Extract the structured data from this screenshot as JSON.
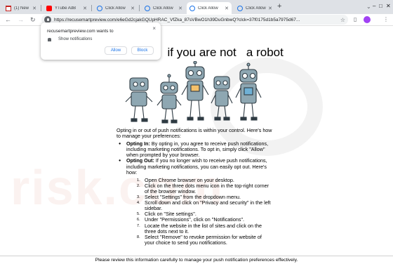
{
  "browser": {
    "tabs": [
      {
        "label": "(1) New M",
        "icon": "gmail-icon"
      },
      {
        "label": "YTube AdB",
        "icon": "youtube-icon"
      },
      {
        "label": "Click Allow",
        "icon": "globe-icon"
      },
      {
        "label": "Click Allow",
        "icon": "globe-icon"
      },
      {
        "label": "Click Allow",
        "icon": "globe-icon"
      },
      {
        "label": "Click Allow",
        "icon": "globe-icon"
      }
    ],
    "new_tab": "+",
    "window_controls": [
      "–",
      "□",
      "✕"
    ],
    "url": "https://recusemartpreview.com/e6eGd2cjakGQUpHRAC_VfZka_87sVBwO1h39DuGnbwQ?clck=37f0175d1b5a7975d67..."
  },
  "popup": {
    "title": "recusemartpreview.com wants to",
    "permission": "Show notifications",
    "allow_label": "Allow",
    "block_label": "Block",
    "close": "×"
  },
  "page": {
    "headline": "\"  if you are not   a robot",
    "intro": "Opting in or out of push notifications is within your control. Here's how to manage your preferences:",
    "bullets": [
      {
        "bold": "Opting In:",
        "text": " By opting in, you agree to receive push notifications, including marketing notifications. To opt in, simply click \"Allow\" when prompted by your browser."
      },
      {
        "bold": "Opting Out:",
        "text": " If you no longer wish to receive push notifications, including marketing notifications, you can easily opt out. Here's how:"
      }
    ],
    "steps": [
      "Open Chrome browser on your desktop.",
      "Click on the three dots menu icon in the top-right corner of the browser window.",
      "Select \"Settings\" from the dropdown menu.",
      "Scroll down and click on \"Privacy and security\" in the left sidebar.",
      "Click on \"Site settings\".",
      "Under \"Permissions\", click on \"Notifications\".",
      "Locate the website in the list of sites and click on the three dots next to it.",
      "Select \"Remove\" to revoke permission for website of your choice to send you notifications."
    ],
    "footer": "Please review this information carefully to manage your push notification preferences effectively."
  },
  "watermark": "risk.com",
  "colors": {
    "tab_strip": "#dee1e6",
    "accent": "#1a73e8",
    "robot_metal": "#8ea7b2"
  }
}
